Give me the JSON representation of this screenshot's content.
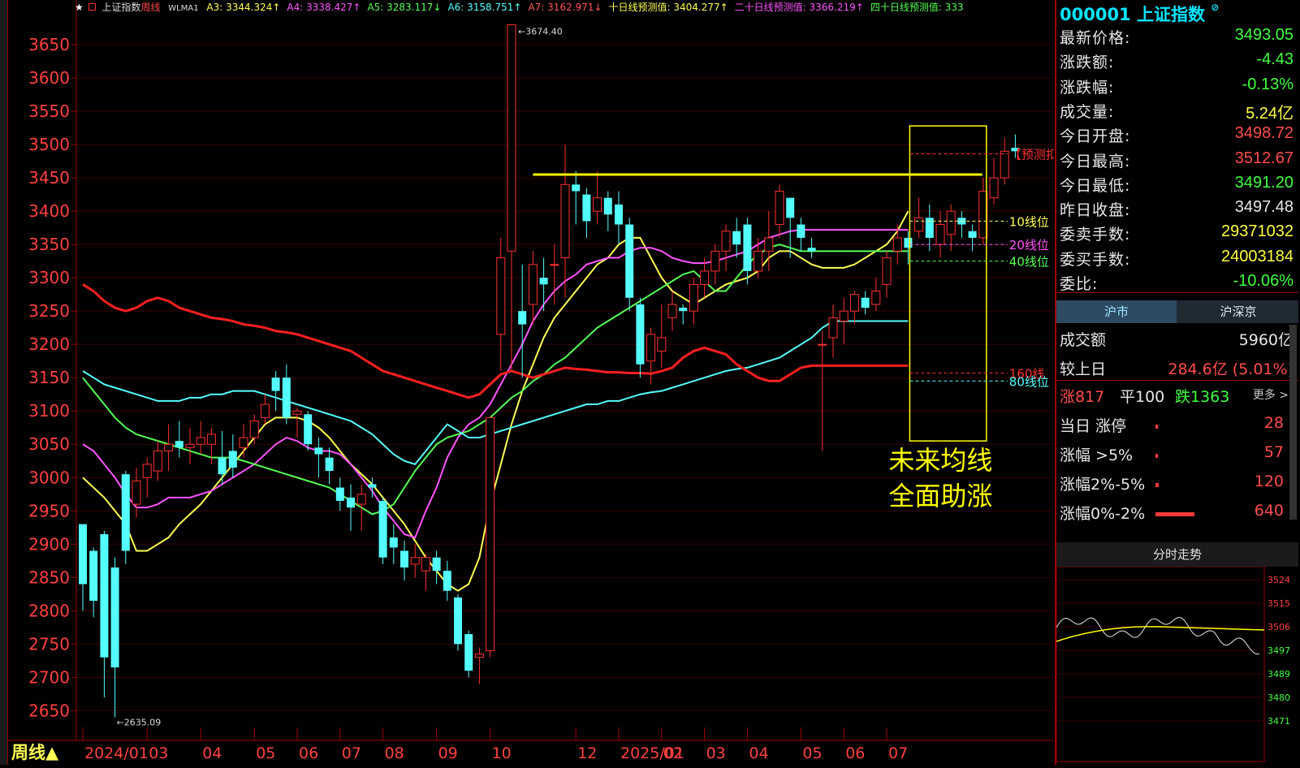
{
  "app": {
    "index_name": "上证指数",
    "period_label": "周线",
    "period_button": "周线▲",
    "star_glyph": "★"
  },
  "ma_legend": {
    "wlma": "WLMA1",
    "items": [
      {
        "label": "A3: 3344.324↑",
        "color": "#ffff54"
      },
      {
        "label": "A4: 3338.427↑",
        "color": "#ff54ff"
      },
      {
        "label": "A5: 3283.117↓",
        "color": "#54ff54"
      },
      {
        "label": "A6: 3158.751↑",
        "color": "#54ffff"
      },
      {
        "label": "A7: 3162.971↓",
        "color": "#ff5454"
      },
      {
        "label": "十日线预测值: 3404.277↑",
        "color": "#ffff54"
      },
      {
        "label": "二十日线预测值: 3366.219↑",
        "color": "#ff54ff"
      },
      {
        "label": "四十日线预测值: 333",
        "color": "#54ff54"
      }
    ]
  },
  "annotations": {
    "max_label": "←3674.40",
    "min_label": "←2635.09",
    "forecast_label": "【预测扣无",
    "ma10_label": "10线位",
    "ma20_label": "20线位",
    "ma40_label": "40线位",
    "ma160_label": "160线",
    "ma80_label": "80线位",
    "note_line1": "未来均线",
    "note_line2": "全面助涨"
  },
  "chart_data": {
    "type": "candlestick",
    "y_ticks": [
      3650,
      3600,
      3550,
      3500,
      3450,
      3400,
      3350,
      3300,
      3250,
      3200,
      3150,
      3100,
      3050,
      3000,
      2950,
      2900,
      2850,
      2800,
      2750,
      2700,
      2650
    ],
    "ylim": [
      2620,
      3700
    ],
    "x_labels": [
      {
        "label": "2024/01",
        "index": 0
      },
      {
        "label": "03",
        "index": 6
      },
      {
        "label": "04",
        "index": 11
      },
      {
        "label": "05",
        "index": 16
      },
      {
        "label": "06",
        "index": 20
      },
      {
        "label": "07",
        "index": 24
      },
      {
        "label": "08",
        "index": 28
      },
      {
        "label": "09",
        "index": 33
      },
      {
        "label": "10",
        "index": 38
      },
      {
        "label": "12",
        "index": 46
      },
      {
        "label": "2025/01",
        "index": 50
      },
      {
        "label": "02",
        "index": 54
      },
      {
        "label": "03",
        "index": 58
      },
      {
        "label": "04",
        "index": 62
      },
      {
        "label": "05",
        "index": 67
      },
      {
        "label": "06",
        "index": 71
      },
      {
        "label": "07",
        "index": 75
      }
    ],
    "candles": [
      [
        2930,
        2840,
        2905,
        2800
      ],
      [
        2890,
        2815,
        2895,
        2790
      ],
      [
        2915,
        2730,
        2920,
        2670
      ],
      [
        2865,
        2715,
        2880,
        2640
      ],
      [
        3005,
        2890,
        3010,
        2870
      ],
      [
        2960,
        2995,
        3015,
        2940
      ],
      [
        3000,
        3020,
        3030,
        2970
      ],
      [
        3010,
        3040,
        3055,
        2995
      ],
      [
        3040,
        3050,
        3080,
        3010
      ],
      [
        3055,
        3045,
        3085,
        3030
      ],
      [
        3045,
        3050,
        3075,
        3020
      ],
      [
        3050,
        3060,
        3085,
        3035
      ],
      [
        3050,
        3065,
        3075,
        3020
      ],
      [
        3030,
        3005,
        3070,
        2990
      ],
      [
        3040,
        3015,
        3065,
        3000
      ],
      [
        3045,
        3060,
        3080,
        3030
      ],
      [
        3060,
        3085,
        3095,
        3050
      ],
      [
        3090,
        3110,
        3125,
        3080
      ],
      [
        3150,
        3130,
        3160,
        3100
      ],
      [
        3150,
        3090,
        3170,
        3080
      ],
      [
        3095,
        3100,
        3105,
        3060
      ],
      [
        3095,
        3050,
        3100,
        3040
      ],
      [
        3045,
        3035,
        3060,
        3000
      ],
      [
        3030,
        3010,
        3045,
        2990
      ],
      [
        2985,
        2965,
        3000,
        2950
      ],
      [
        2970,
        2955,
        2990,
        2920
      ],
      [
        2960,
        2975,
        2990,
        2920
      ],
      [
        2990,
        2985,
        3000,
        2970
      ],
      [
        2965,
        2880,
        2970,
        2870
      ],
      [
        2910,
        2895,
        2930,
        2870
      ],
      [
        2890,
        2865,
        2905,
        2845
      ],
      [
        2870,
        2880,
        2900,
        2850
      ],
      [
        2860,
        2880,
        2885,
        2830
      ],
      [
        2880,
        2860,
        2890,
        2840
      ],
      [
        2860,
        2830,
        2875,
        2815
      ],
      [
        2820,
        2750,
        2825,
        2740
      ],
      [
        2765,
        2710,
        2770,
        2700
      ],
      [
        2730,
        2735,
        2745,
        2690
      ],
      [
        2740,
        3090,
        3090,
        2730
      ],
      [
        3215,
        3330,
        3360,
        3160
      ],
      [
        3340,
        3680,
        3680,
        3160
      ],
      [
        3250,
        3230,
        3320,
        3150
      ],
      [
        3260,
        3320,
        3340,
        3230
      ],
      [
        3300,
        3290,
        3330,
        3250
      ],
      [
        3320,
        3320,
        3350,
        3260
      ],
      [
        3330,
        3440,
        3500,
        3270
      ],
      [
        3440,
        3430,
        3460,
        3380
      ],
      [
        3425,
        3385,
        3435,
        3360
      ],
      [
        3400,
        3420,
        3460,
        3380
      ],
      [
        3420,
        3395,
        3430,
        3370
      ],
      [
        3410,
        3380,
        3430,
        3350
      ],
      [
        3380,
        3270,
        3390,
        3250
      ],
      [
        3260,
        3170,
        3270,
        3150
      ],
      [
        3175,
        3215,
        3225,
        3140
      ],
      [
        3190,
        3210,
        3260,
        3165
      ],
      [
        3240,
        3260,
        3280,
        3220
      ],
      [
        3255,
        3250,
        3260,
        3230
      ],
      [
        3250,
        3290,
        3300,
        3230
      ],
      [
        3290,
        3310,
        3330,
        3270
      ],
      [
        3310,
        3340,
        3350,
        3290
      ],
      [
        3340,
        3370,
        3380,
        3310
      ],
      [
        3370,
        3350,
        3390,
        3330
      ],
      [
        3380,
        3310,
        3390,
        3290
      ],
      [
        3310,
        3340,
        3360,
        3300
      ],
      [
        3340,
        3360,
        3400,
        3310
      ],
      [
        3380,
        3430,
        3440,
        3360
      ],
      [
        3420,
        3390,
        3420,
        3330
      ],
      [
        3380,
        3360,
        3390,
        3340
      ],
      [
        3345,
        3340,
        3360,
        3330
      ],
      [
        3200,
        3200,
        3220,
        3040
      ],
      [
        3210,
        3240,
        3260,
        3180
      ],
      [
        3235,
        3250,
        3270,
        3200
      ],
      [
        3250,
        3275,
        3280,
        3230
      ],
      [
        3270,
        3255,
        3280,
        3245
      ],
      [
        3260,
        3280,
        3300,
        3250
      ],
      [
        3290,
        3330,
        3340,
        3270
      ],
      [
        3340,
        3360,
        3380,
        3320
      ],
      [
        3360,
        3345,
        3370,
        3320
      ],
      [
        3370,
        3390,
        3420,
        3360
      ],
      [
        3390,
        3360,
        3410,
        3340
      ],
      [
        3350,
        3380,
        3400,
        3330
      ],
      [
        3365,
        3400,
        3410,
        3340
      ],
      [
        3390,
        3380,
        3400,
        3360
      ],
      [
        3370,
        3360,
        3380,
        3340
      ],
      [
        3360,
        3430,
        3450,
        3350
      ],
      [
        3420,
        3450,
        3480,
        3410
      ],
      [
        3450,
        3490,
        3510,
        3440
      ],
      [
        3495,
        3490,
        3515,
        3480
      ]
    ],
    "series": [
      {
        "name": "A3",
        "color": "#ffff54",
        "values": [
          3000,
          2985,
          2970,
          2950,
          2930,
          2890,
          2890,
          2900,
          2910,
          2930,
          2945,
          2960,
          2980,
          3000,
          3020,
          3040,
          3060,
          3080,
          3090,
          3090,
          3090,
          3085,
          3075,
          3060,
          3040,
          3020,
          3005,
          2990,
          2970,
          2950,
          2930,
          2905,
          2880,
          2860,
          2840,
          2830,
          2840,
          2880,
          2960,
          3020,
          3080,
          3130,
          3170,
          3210,
          3240,
          3260,
          3280,
          3300,
          3320,
          3330,
          3350,
          3360,
          3360,
          3330,
          3300,
          3280,
          3270,
          3260,
          3270,
          3280,
          3290,
          3295,
          3300,
          3310,
          3330,
          3340,
          3340,
          3330,
          3320,
          3315,
          3315,
          3315,
          3320,
          3330,
          3340,
          3350,
          3370,
          3400
        ]
      },
      {
        "name": "A4",
        "color": "#ff54ff",
        "values": [
          3050,
          3040,
          3020,
          3000,
          2975,
          2955,
          2955,
          2960,
          2970,
          2970,
          2970,
          2975,
          2980,
          2990,
          3000,
          3010,
          3020,
          3035,
          3050,
          3060,
          3055,
          3045,
          3040,
          3040,
          3035,
          3020,
          3000,
          2980,
          2955,
          2935,
          2915,
          2910,
          2950,
          2985,
          3030,
          3060,
          3080,
          3090,
          3110,
          3140,
          3170,
          3200,
          3235,
          3260,
          3280,
          3295,
          3305,
          3320,
          3325,
          3330,
          3330,
          3340,
          3345,
          3345,
          3340,
          3330,
          3325,
          3322,
          3322,
          3325,
          3330,
          3335,
          3340,
          3350,
          3360,
          3365,
          3370,
          3372,
          3372,
          3372,
          3372,
          3372,
          3372,
          3372,
          3372,
          3372,
          3372,
          3372
        ]
      },
      {
        "name": "A5",
        "color": "#54ff54",
        "values": [
          3150,
          3130,
          3110,
          3090,
          3075,
          3065,
          3060,
          3055,
          3050,
          3045,
          3040,
          3035,
          3030,
          3030,
          3030,
          3025,
          3020,
          3015,
          3010,
          3005,
          3000,
          2995,
          2990,
          2985,
          2975,
          2965,
          2955,
          2945,
          2950,
          2960,
          2985,
          3010,
          3030,
          3050,
          3060,
          3065,
          3070,
          3080,
          3090,
          3105,
          3120,
          3130,
          3145,
          3155,
          3170,
          3180,
          3195,
          3210,
          3225,
          3235,
          3245,
          3255,
          3265,
          3275,
          3285,
          3295,
          3305,
          3310,
          3295,
          3280,
          3280,
          3300,
          3320,
          3335,
          3345,
          3350,
          3345,
          3340,
          3340,
          3340,
          3340,
          3340,
          3340,
          3340,
          3340,
          3340,
          3340,
          3340
        ]
      },
      {
        "name": "A6",
        "color": "#54ffff",
        "values": [
          3160,
          3150,
          3140,
          3135,
          3130,
          3125,
          3120,
          3115,
          3115,
          3115,
          3120,
          3120,
          3125,
          3125,
          3130,
          3130,
          3130,
          3125,
          3120,
          3115,
          3110,
          3105,
          3100,
          3095,
          3090,
          3085,
          3075,
          3065,
          3050,
          3035,
          3025,
          3020,
          3040,
          3060,
          3080,
          3070,
          3060,
          3060,
          3065,
          3070,
          3075,
          3080,
          3085,
          3090,
          3095,
          3100,
          3105,
          3110,
          3110,
          3115,
          3115,
          3120,
          3125,
          3128,
          3130,
          3135,
          3140,
          3145,
          3150,
          3155,
          3160,
          3163,
          3165,
          3170,
          3175,
          3180,
          3190,
          3200,
          3210,
          3225,
          3235,
          3235,
          3235,
          3235,
          3235,
          3235,
          3235,
          3235
        ]
      },
      {
        "name": "A7",
        "color": "#ff2020",
        "values": [
          3290,
          3280,
          3265,
          3255,
          3250,
          3255,
          3265,
          3270,
          3265,
          3255,
          3250,
          3245,
          3240,
          3238,
          3235,
          3230,
          3228,
          3225,
          3220,
          3218,
          3215,
          3210,
          3205,
          3200,
          3195,
          3190,
          3180,
          3170,
          3160,
          3155,
          3150,
          3145,
          3140,
          3135,
          3130,
          3125,
          3120,
          3125,
          3140,
          3155,
          3160,
          3155,
          3150,
          3155,
          3160,
          3165,
          3163,
          3162,
          3160,
          3158,
          3158,
          3157,
          3157,
          3156,
          3160,
          3165,
          3180,
          3190,
          3195,
          3190,
          3185,
          3170,
          3160,
          3150,
          3145,
          3145,
          3155,
          3165,
          3168,
          3168,
          3168,
          3168,
          3168,
          3168,
          3168,
          3168,
          3168,
          3168
        ]
      }
    ]
  },
  "quote": {
    "code": "000001",
    "name": "上证指数",
    "rows": [
      {
        "label": "最新价格:",
        "value": "3493.05",
        "color": "#40ff40"
      },
      {
        "label": "涨跌额:",
        "value": "-4.43",
        "color": "#40ff40"
      },
      {
        "label": "涨跌幅:",
        "value": "-0.13%",
        "color": "#40ff40"
      },
      {
        "label": "成交量:",
        "value": "5.24亿",
        "color": "#ffff40"
      },
      {
        "label": "今日开盘:",
        "value": "3498.72",
        "color": "#ff4d4d"
      },
      {
        "label": "今日最高:",
        "value": "3512.67",
        "color": "#ff4d4d"
      },
      {
        "label": "今日最低:",
        "value": "3491.20",
        "color": "#40ff40"
      },
      {
        "label": "昨日收盘:",
        "value": "3497.48",
        "color": "#e8e8e8"
      },
      {
        "label": "委卖手数:",
        "value": "29371032",
        "color": "#ffff40"
      },
      {
        "label": "委买手数:",
        "value": "24003184",
        "color": "#ffff40"
      },
      {
        "label": "委比:",
        "value": "-10.06%",
        "color": "#40ff40"
      }
    ]
  },
  "tabs": [
    "沪市",
    "沪深京"
  ],
  "market": {
    "turnover_label": "成交额",
    "turnover_value": "5960亿",
    "vs_yesterday_label": "较上日",
    "vs_yesterday_value": "284.6亿 (5.01%)",
    "up_label": "涨817",
    "flat_label": "平100",
    "down_label": "跌1363",
    "more_label": "更多 >",
    "rows": [
      {
        "label": "当日 涨停",
        "value": "28",
        "bar_fraction": 0.01
      },
      {
        "label": "涨幅 >5%",
        "value": "57",
        "bar_fraction": 0.02
      },
      {
        "label": "涨幅2%-5%",
        "value": "120",
        "bar_fraction": 0.05
      },
      {
        "label": "涨幅0%-2%",
        "value": "640",
        "bar_fraction": 0.6
      }
    ]
  },
  "intraday": {
    "title": "分时走势",
    "y_ticks": [
      "3524",
      "3515",
      "3506",
      "3497",
      "3489",
      "3480",
      "3471"
    ]
  }
}
